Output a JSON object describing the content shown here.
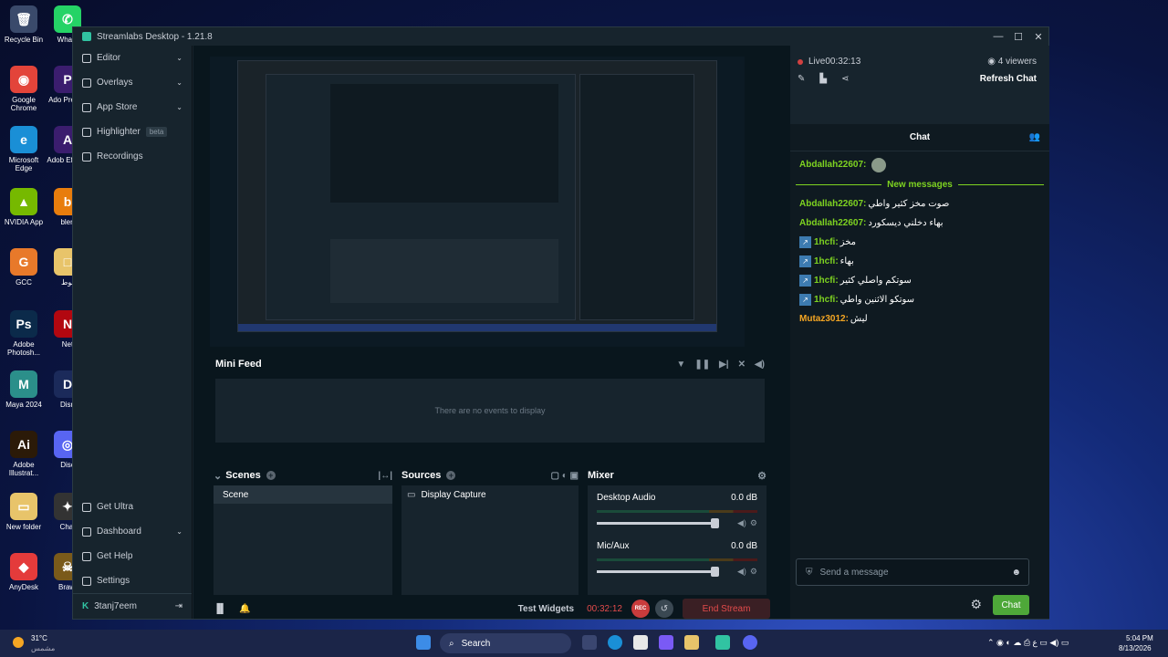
{
  "desktop": {
    "icons": [
      {
        "label": "Recycle Bin",
        "glyph": "🗑",
        "color": "#3a4a6b"
      },
      {
        "label": "Whats",
        "glyph": "✆",
        "color": "#25d366"
      },
      {
        "label": "Google Chrome",
        "glyph": "◉",
        "color": "#e3443a"
      },
      {
        "label": "Ado Premie",
        "glyph": "P",
        "color": "#3b1d6e"
      },
      {
        "label": "Microsoft Edge",
        "glyph": "e",
        "color": "#1a8fd6"
      },
      {
        "label": "Adob Effects",
        "glyph": "A",
        "color": "#3b1d6e"
      },
      {
        "label": "NVIDIA App",
        "glyph": "▲",
        "color": "#76b900"
      },
      {
        "label": "blen",
        "glyph": "b",
        "color": "#e87d0d"
      },
      {
        "label": "GCC",
        "glyph": "G",
        "color": "#e8792a"
      },
      {
        "label": "لوط",
        "glyph": "□",
        "color": "#e8c46a"
      },
      {
        "label": "Adobe Photosh...",
        "glyph": "Ps",
        "color": "#0b2a4a"
      },
      {
        "label": "Net",
        "glyph": "N",
        "color": "#b20710"
      },
      {
        "label": "Maya 2024",
        "glyph": "M",
        "color": "#2b8f8a"
      },
      {
        "label": "Disn",
        "glyph": "D",
        "color": "#1b2a5a"
      },
      {
        "label": "Adobe Illustrat...",
        "glyph": "Ai",
        "color": "#2b1a08"
      },
      {
        "label": "Disc",
        "glyph": "◎",
        "color": "#5865f2"
      },
      {
        "label": "New folder",
        "glyph": "▭",
        "color": "#e8c46a"
      },
      {
        "label": "Chat",
        "glyph": "✦",
        "color": "#333"
      },
      {
        "label": "AnyDesk",
        "glyph": "◆",
        "color": "#e43b3b"
      },
      {
        "label": "Brawl",
        "glyph": "☠",
        "color": "#7a5a1a"
      }
    ]
  },
  "window": {
    "title": "Streamlabs Desktop - 1.21.8",
    "controls": [
      "—",
      "☐",
      "✕"
    ]
  },
  "sidebar": {
    "items": [
      {
        "label": "Editor",
        "chevron": "⌄"
      },
      {
        "label": "Overlays",
        "chevron": "⌄"
      },
      {
        "label": "App Store",
        "chevron": "⌄"
      },
      {
        "label": "Highlighter",
        "badge": "beta"
      },
      {
        "label": "Recordings"
      }
    ],
    "bottom_items": [
      {
        "label": "Get Ultra"
      },
      {
        "label": "Dashboard",
        "chevron": "⌄"
      },
      {
        "label": "Get Help"
      },
      {
        "label": "Settings"
      }
    ],
    "user": {
      "name": "3tanj7eem",
      "logout": "⇥"
    }
  },
  "mini_feed": {
    "title": "Mini Feed",
    "empty_text": "There are no events to display"
  },
  "scenes": {
    "title": "Scenes",
    "items": [
      "Scene"
    ]
  },
  "sources": {
    "title": "Sources",
    "items": [
      "Display Capture"
    ]
  },
  "mixer": {
    "title": "Mixer",
    "channels": [
      {
        "name": "Desktop Audio",
        "level": "0.0 dB"
      },
      {
        "name": "Mic/Aux",
        "level": "0.0 dB"
      }
    ]
  },
  "footer": {
    "test_widgets": "Test Widgets",
    "timer": "00:32:12",
    "rec": "REC",
    "end_stream": "End Stream"
  },
  "chat": {
    "live_label": "Live",
    "live_time": "00:32:13",
    "viewers": "4 viewers",
    "refresh": "Refresh Chat",
    "header": "Chat",
    "new_messages": "New messages",
    "messages": [
      {
        "user": "Abdallah22607:",
        "text": "",
        "color": "#7ed321",
        "badge": false,
        "position": "before-sep"
      },
      {
        "user": "Abdallah22607:",
        "text": "صوت مخز كثير واطي",
        "color": "#7ed321",
        "badge": false
      },
      {
        "user": "Abdallah22607:",
        "text": "بهاء دخلني ديسكورد",
        "color": "#7ed321",
        "badge": false
      },
      {
        "user": "1hcfi:",
        "text": "مخز",
        "color": "#7ed321",
        "badge": true
      },
      {
        "user": "1hcfi:",
        "text": "بهاء",
        "color": "#7ed321",
        "badge": true
      },
      {
        "user": "1hcfi:",
        "text": "سوتكم واصلي كثير",
        "color": "#7ed321",
        "badge": true
      },
      {
        "user": "1hcfi:",
        "text": "سوتكو الاثنين واطي",
        "color": "#7ed321",
        "badge": true
      },
      {
        "user": "Mutaz3012:",
        "text": "ليش",
        "color": "#f5a623",
        "badge": false
      }
    ],
    "input_placeholder": "Send a message",
    "send_label": "Chat"
  },
  "taskbar": {
    "weather_temp": "31°C",
    "weather_desc": "مشمس",
    "search": "Search",
    "time": "5:04 PM",
    "date": "8/13/2026"
  }
}
